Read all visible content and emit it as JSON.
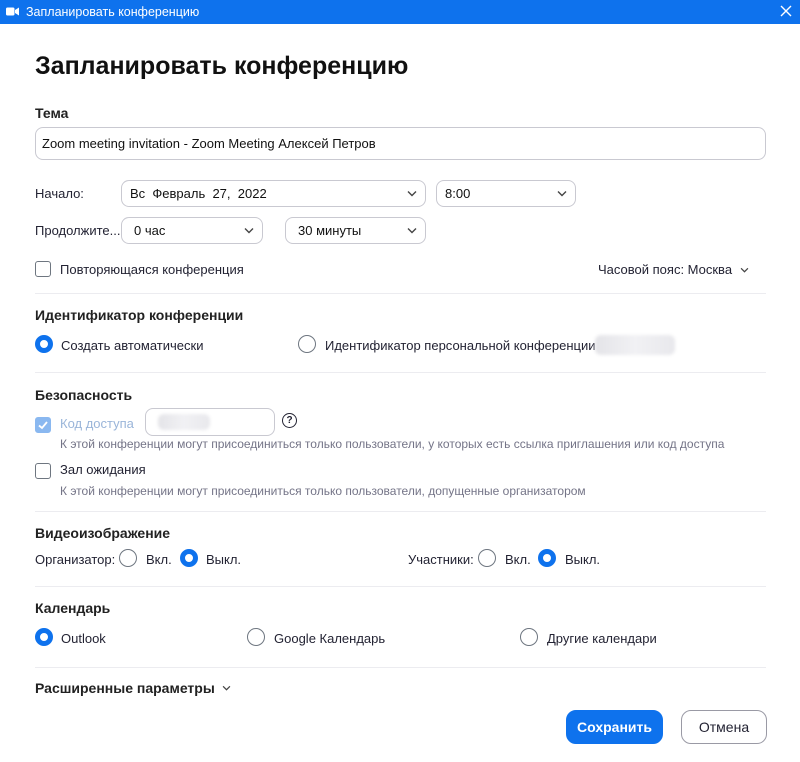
{
  "window": {
    "title": "Запланировать конференцию"
  },
  "heading": "Запланировать конференцию",
  "topic": {
    "label": "Тема",
    "value": "Zoom meeting invitation - Zoom Meeting Алексей Петров"
  },
  "start": {
    "label": "Начало:",
    "date": "Вс  Февраль  27,  2022",
    "time": "8:00"
  },
  "duration": {
    "label": "Продолжите...",
    "hours": "0 час",
    "minutes": "30 минуты"
  },
  "recurring": {
    "label": "Повторяющаяся конференция",
    "checked": false
  },
  "timezone": {
    "label": "Часовой пояс: Москва"
  },
  "meeting_id": {
    "title": "Идентификатор конференции",
    "options": [
      {
        "label": "Создать автоматически",
        "selected": true
      },
      {
        "label": "Идентификатор персональной конференции",
        "selected": false
      }
    ]
  },
  "security": {
    "title": "Безопасность",
    "passcode": {
      "label": "Код доступа",
      "checked": true,
      "disabled": true
    },
    "passcode_hint": "К этой конференции могут присоединиться только пользователи, у которых есть ссылка приглашения или код доступа",
    "waiting_room": {
      "label": "Зал ожидания",
      "checked": false
    },
    "waiting_room_hint": "К этой конференции могут присоединиться только пользователи, допущенные организатором",
    "help_glyph": "?"
  },
  "video": {
    "title": "Видеоизображение",
    "host": {
      "label": "Организатор:",
      "on": "Вкл.",
      "off": "Выкл.",
      "selected": "off"
    },
    "participants": {
      "label": "Участники:",
      "on": "Вкл.",
      "off": "Выкл.",
      "selected": "off"
    }
  },
  "calendar": {
    "title": "Календарь",
    "options": [
      {
        "label": "Outlook",
        "selected": true
      },
      {
        "label": "Google Календарь",
        "selected": false
      },
      {
        "label": "Другие календари",
        "selected": false
      }
    ]
  },
  "advanced": {
    "label": "Расширенные параметры"
  },
  "buttons": {
    "save": "Сохранить",
    "cancel": "Отмена"
  },
  "colors": {
    "accent": "#0e72ed",
    "title_bar": "#0e72ed",
    "hint_text": "#747487"
  }
}
